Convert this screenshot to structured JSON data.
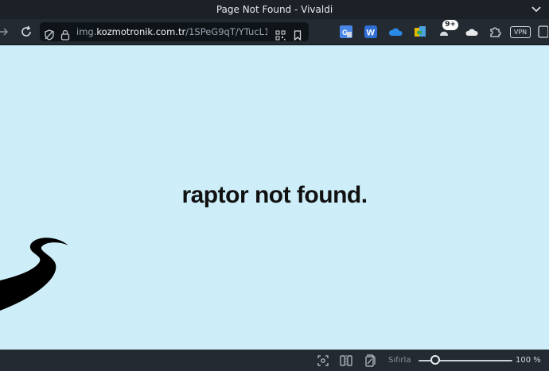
{
  "window": {
    "title": "Page Not Found - Vivaldi"
  },
  "toolbar": {
    "url_prefix": "img.",
    "url_domain": "kozmotronik.com.tr",
    "url_path": "/1SPeG9qT/YTucL1...",
    "extension_badge": "9+",
    "vpn_label": "VPN"
  },
  "page": {
    "headline": "raptor not found."
  },
  "statusbar": {
    "reset_label": "Sıfırla",
    "zoom_level": "100 %"
  },
  "colors": {
    "page_bg": "#cdeef8",
    "chrome_bg": "#232a32",
    "titlebar_bg": "#1c2127"
  }
}
